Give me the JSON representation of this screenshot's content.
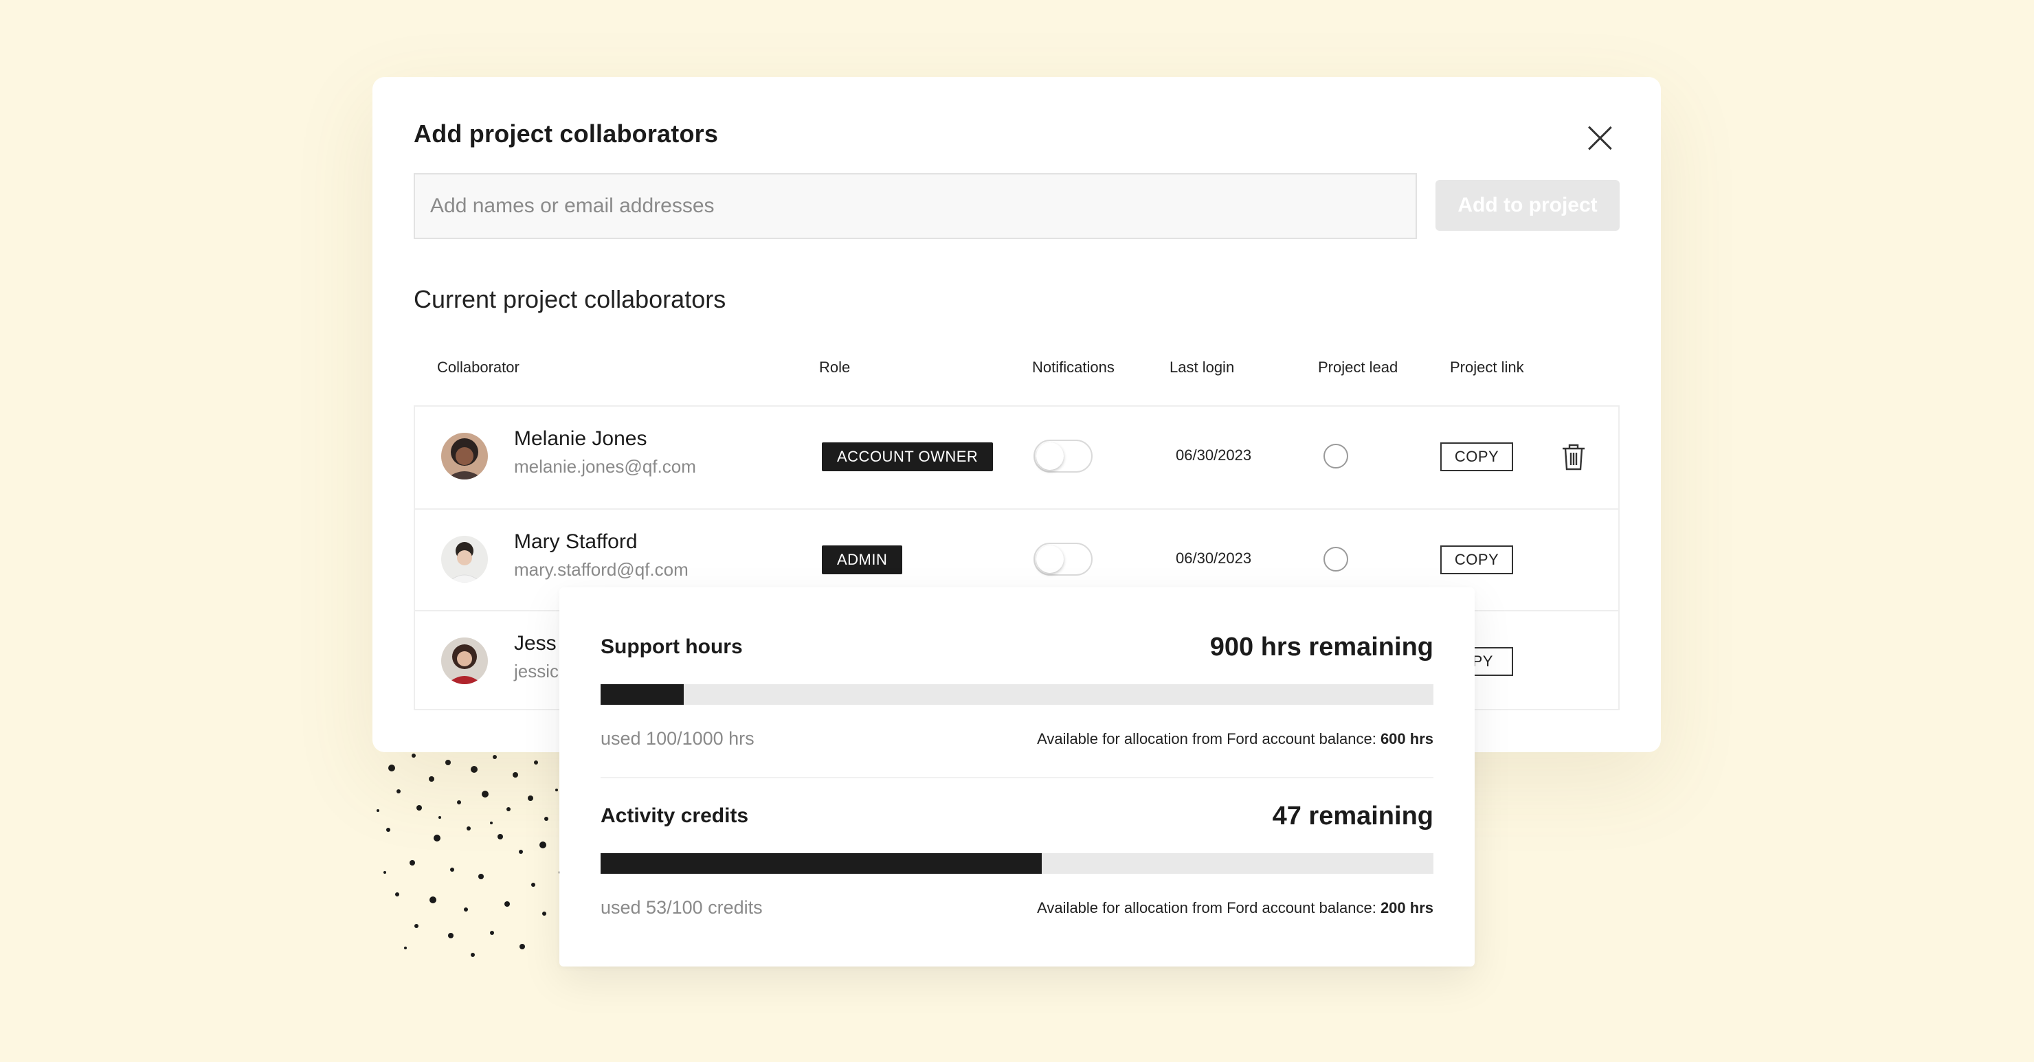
{
  "modal": {
    "title": "Add project collaborators",
    "search_placeholder": "Add names or email addresses",
    "add_button": "Add to project",
    "section_title": "Current project collaborators"
  },
  "table": {
    "columns": [
      "Collaborator",
      "Role",
      "Notifications",
      "Last login",
      "Project lead",
      "Project link"
    ],
    "rows": [
      {
        "name": "Melanie Jones",
        "email": "melanie.jones@qf.com",
        "role": "ACCOUNT OWNER",
        "notifications": false,
        "last_login": "06/30/2023",
        "project_lead": false,
        "link_label": "COPY",
        "deletable": true
      },
      {
        "name": "Mary Stafford",
        "email": "mary.stafford@qf.com",
        "role": "ADMIN",
        "notifications": false,
        "last_login": "06/30/2023",
        "project_lead": false,
        "link_label": "COPY",
        "deletable": false
      },
      {
        "name": "Jess",
        "email": "jessic",
        "link_label": "OPY",
        "deletable": false
      }
    ]
  },
  "usage": {
    "support": {
      "title": "Support hours",
      "remaining": "900 hrs remaining",
      "used_fraction": 0.1,
      "used_text": "used 100/1000 hrs",
      "avail_text": "Available for allocation from Ford account balance:",
      "avail_value": "600 hrs"
    },
    "credits": {
      "title": "Activity credits",
      "remaining": "47 remaining",
      "used_fraction": 0.53,
      "used_text": "used 53/100 credits",
      "avail_text": "Available for allocation from Ford account balance:",
      "avail_value": "200 hrs"
    }
  },
  "colors": {
    "background": "#fdf7e1",
    "accent_dark": "#1c1c1c",
    "muted_text": "#8a8a8a"
  }
}
